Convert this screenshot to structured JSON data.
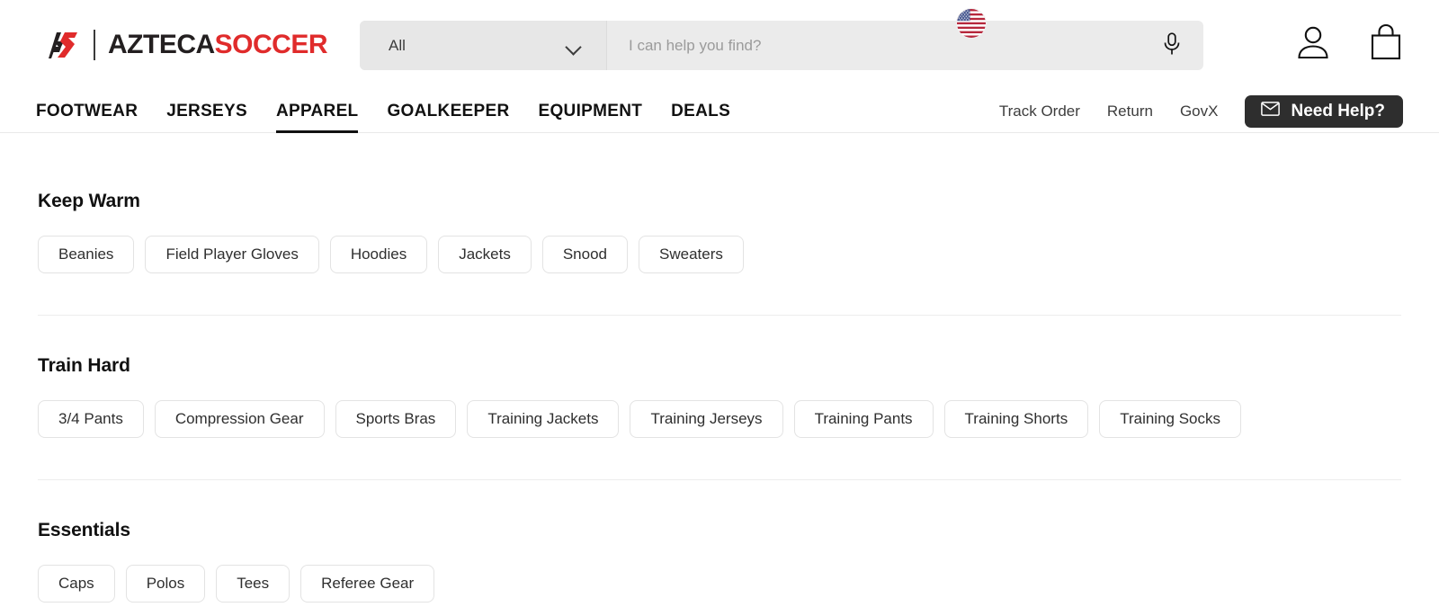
{
  "brand": {
    "logo_mark_alt": "azteca-soccer-monogram",
    "name_part1": "AZTECA",
    "name_part2": "SOCCER",
    "color_black": "#231f20",
    "color_red": "#e02b2b"
  },
  "search": {
    "category_selected": "All",
    "category_options": [
      "All"
    ],
    "placeholder": "I can help you find?",
    "value": "",
    "mic_icon": "microphone-icon",
    "locale_flag": "us-flag-icon"
  },
  "header_icons": {
    "account": "user-account-icon",
    "cart": "shopping-bag-icon"
  },
  "nav": {
    "items": [
      {
        "label": "FOOTWEAR",
        "active": false
      },
      {
        "label": "JERSEYS",
        "active": false
      },
      {
        "label": "APPAREL",
        "active": true
      },
      {
        "label": "GOALKEEPER",
        "active": false
      },
      {
        "label": "EQUIPMENT",
        "active": false
      },
      {
        "label": "DEALS",
        "active": false
      }
    ],
    "utility_links": [
      "Track Order",
      "Return",
      "GovX"
    ],
    "help_button": {
      "label": "Need Help?",
      "icon": "envelope-icon",
      "background": "#2e2e2e",
      "text_color": "#ffffff"
    }
  },
  "sections": [
    {
      "title": "Keep Warm",
      "chips": [
        "Beanies",
        "Field Player Gloves",
        "Hoodies",
        "Jackets",
        "Snood",
        "Sweaters"
      ]
    },
    {
      "title": "Train Hard",
      "chips": [
        "3/4 Pants",
        "Compression Gear",
        "Sports Bras",
        "Training Jackets",
        "Training Jerseys",
        "Training Pants",
        "Training Shorts",
        "Training Socks"
      ]
    },
    {
      "title": "Essentials",
      "chips": [
        "Caps",
        "Polos",
        "Tees",
        "Referee Gear"
      ]
    }
  ]
}
